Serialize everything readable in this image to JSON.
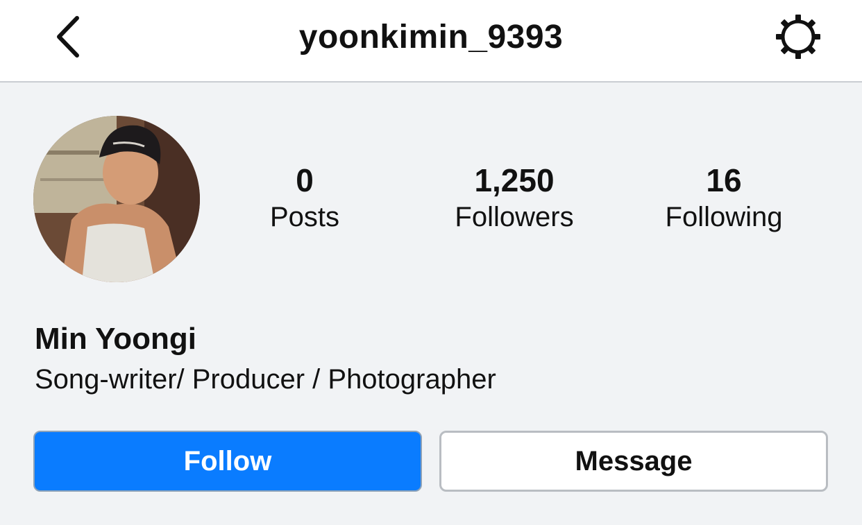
{
  "header": {
    "username": "yoonkimin_9393",
    "back_icon": "chevron-left-icon",
    "settings_icon": "gear-icon"
  },
  "profile": {
    "name": "Min Yoongi",
    "bio": "Song-writer/ Producer / Photographer",
    "avatar_alt": "profile photo"
  },
  "stats": [
    {
      "value": "0",
      "label": "Posts"
    },
    {
      "value": "1,250",
      "label": "Followers"
    },
    {
      "value": "16",
      "label": "Following"
    }
  ],
  "actions": {
    "follow_label": "Follow",
    "message_label": "Message"
  },
  "colors": {
    "follow_bg": "#0a7cff",
    "page_bg": "#f1f3f5"
  }
}
